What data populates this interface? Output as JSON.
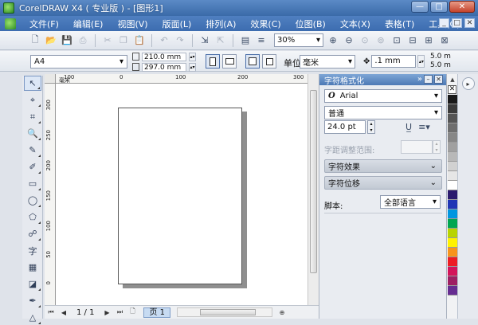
{
  "window": {
    "title": "CorelDRAW X4 ( 专业版 ) - [图形1]",
    "buttons": {
      "minimize": "—",
      "maximize": "□",
      "close": "✕"
    }
  },
  "menu": {
    "items": [
      "文件(F)",
      "编辑(E)",
      "视图(V)",
      "版面(L)",
      "排列(A)",
      "效果(C)",
      "位图(B)",
      "文本(X)",
      "表格(T)",
      "工具(O)"
    ],
    "controls": [
      "_",
      "□",
      "✕"
    ]
  },
  "standard_toolbar": {
    "zoom_value": "30%",
    "icons": [
      "new-icon",
      "open-icon",
      "save-icon",
      "print-icon",
      "cut-icon",
      "copy-icon",
      "paste-icon",
      "undo-icon",
      "redo-icon",
      "import-icon",
      "export-icon",
      "application-launcher-icon",
      "welcome-icon",
      "zoom-levels",
      "zoom-in-icon",
      "zoom-out-icon",
      "zoom-selected-icon",
      "zoom-all-icon",
      "zoom-page-icon",
      "zoom-width-icon",
      "zoom-height-icon",
      "pan-icon"
    ]
  },
  "property_bar": {
    "page_size": "A4",
    "width": "210.0 mm",
    "height": "297.0 mm",
    "unit_label": "单位:",
    "unit": "毫米",
    "nudge": ".1 mm",
    "duplicate_x": "5.0 m",
    "duplicate_y": "5.0 m"
  },
  "rulers": {
    "x_ticks": [
      "100",
      "0",
      "100",
      "200",
      "300"
    ],
    "x_unit": "毫米",
    "y_ticks": [
      "300",
      "250",
      "200",
      "150",
      "100",
      "50",
      "0"
    ]
  },
  "status": {
    "page_count": "1 / 1",
    "page_tab": "页 1"
  },
  "docker": {
    "title": "字符格式化",
    "font_name": "Arial",
    "font_style": "普通",
    "font_size": "24.0 pt",
    "range_label": "字距调整范围:",
    "sections": [
      "字符效果",
      "字符位移"
    ],
    "script_label": "脚本:",
    "script_value": "全部语言"
  },
  "palette": {
    "colors": [
      "#1a1a1a",
      "#3b3b3b",
      "#555555",
      "#6e6e6e",
      "#878787",
      "#a0a0a0",
      "#b8b8b8",
      "#d1d1d1",
      "#e6e6e6",
      "#ffffff",
      "#2a1a6e",
      "#1f35b5",
      "#0096e0",
      "#00a651",
      "#b8d400",
      "#fff200",
      "#f7941d",
      "#ed1c24",
      "#d4145a",
      "#9e1f63",
      "#662d91"
    ]
  }
}
